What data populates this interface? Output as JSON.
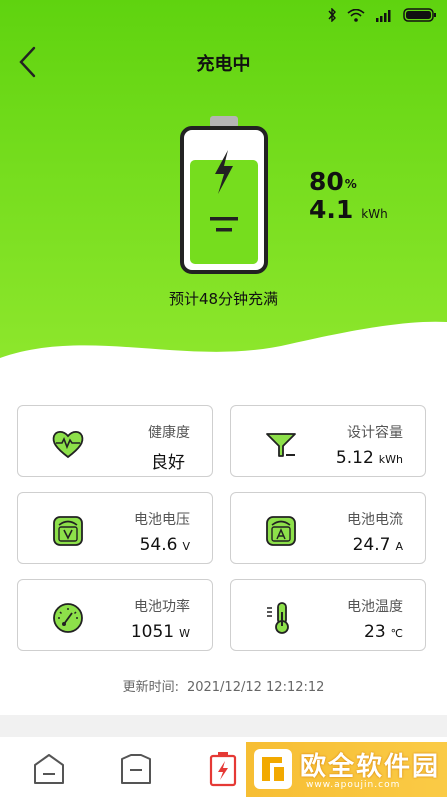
{
  "header": {
    "title": "充电中"
  },
  "battery": {
    "percent": "80",
    "percent_unit": "%",
    "energy": "4.1",
    "energy_unit": "kWh",
    "level_fraction": 0.8,
    "estimate": "预计48分钟充满"
  },
  "cards": [
    {
      "icon": "heart-pulse-icon",
      "label": "健康度",
      "value": "良好",
      "unit": ""
    },
    {
      "icon": "funnel-icon",
      "label": "设计容量",
      "value": "5.12",
      "unit": "kWh"
    },
    {
      "icon": "voltage-icon",
      "label": "电池电压",
      "value": "54.6",
      "unit": "V"
    },
    {
      "icon": "current-icon",
      "label": "电池电流",
      "value": "24.7",
      "unit": "A"
    },
    {
      "icon": "gauge-icon",
      "label": "电池功率",
      "value": "1051",
      "unit": "W"
    },
    {
      "icon": "thermometer-icon",
      "label": "电池温度",
      "value": "23",
      "unit": "℃"
    }
  ],
  "update": {
    "label": "更新时间:",
    "time": "2021/12/12 12:12:12"
  },
  "tabs": [
    {
      "icon": "home-icon"
    },
    {
      "icon": "device-icon"
    },
    {
      "icon": "battery-charging-icon"
    }
  ],
  "watermark": {
    "text": "欧全软件园",
    "url": "www.apoujin.com"
  },
  "colors": {
    "accent": "#76dd1e",
    "icon_green": "#8de04a",
    "active_tab": "#e53935"
  }
}
